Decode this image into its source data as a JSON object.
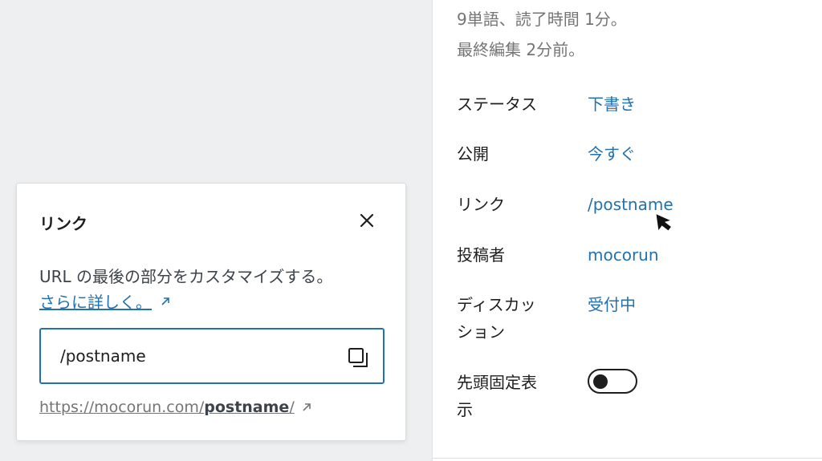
{
  "sidebar": {
    "meta_words": "9単語、読了時間 1分。",
    "meta_edited": "最終編集 2分前。",
    "rows": [
      {
        "label": "ステータス",
        "value": "下書き"
      },
      {
        "label": "公開",
        "value": "今すぐ"
      },
      {
        "label": "リンク",
        "value": "/postname"
      },
      {
        "label": "投稿者",
        "value": "mocorun"
      },
      {
        "label": "ディスカッ\nション",
        "value": "受付中"
      },
      {
        "label": "先頭固定表\n示",
        "value": ""
      }
    ],
    "sticky_toggle_on": false
  },
  "popover": {
    "title": "リンク",
    "description": "URL の最後の部分をカスタマイズする。",
    "learn_more": "さらに詳しく。",
    "slug_value": "/postname",
    "url_base": "https://mocorun.com/",
    "url_slug": "postname",
    "url_trail": "/"
  },
  "colors": {
    "accent": "#2271b1",
    "text": "#1e1e1e",
    "muted": "#757575"
  }
}
